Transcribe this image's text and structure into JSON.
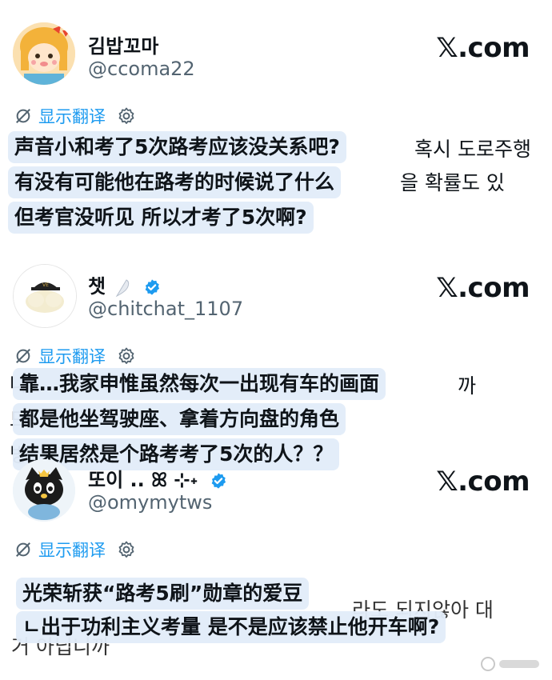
{
  "brand_label": "𝕏.com",
  "translate_label": "显示翻译",
  "colors": {
    "link_blue": "#1d9bf0",
    "overlay_bg": "#e2ecf9",
    "verified_blue": "#1d9bf0",
    "muted": "#536471"
  },
  "posts": [
    {
      "display_name": "김밥꼬마",
      "handle": "@ccoma22",
      "korean_lines": [
        "혹시 도로주행",
        "을 확률도 있"
      ],
      "overlay_lines": [
        "声音小和考了5次路考应该没关系吧?",
        "有没有可能他在路考的时候说了什么",
        "但考官没听见 所以才考了5次啊?"
      ]
    },
    {
      "display_name": "챗",
      "handle": "@chitchat_1107",
      "verified": true,
      "korean_lines": [
        "나",
        "드",
        "빙",
        "까"
      ],
      "overlay_lines": [
        "靠…我家申惟虽然每次一出现有车的画面",
        "都是他坐驾驶座、拿着方向盘的角色",
        "结果居然是个路考考了5次的人？？"
      ]
    },
    {
      "display_name": "또이 .. ꕤ ⊹˖",
      "handle": "@omymytws",
      "verified": true,
      "korean_lines": [
        "거 아닙니까",
        "라도 되지않아 대"
      ],
      "overlay_lines": [
        "光荣斩获“路考5刷”勋章的爱豆",
        "ㄴ出于功利主义考量 是不是应该禁止他开车啊?"
      ]
    }
  ]
}
